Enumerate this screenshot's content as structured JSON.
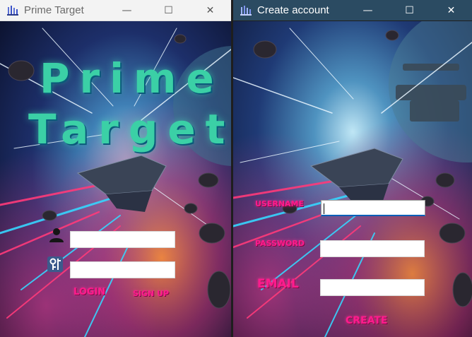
{
  "window_login": {
    "title": "Prime Target",
    "heading_line1": "Prime",
    "heading_line2": "Target",
    "login_label": "LOGIN",
    "signup_label": "SIGN UP",
    "icons": [
      "user-icon",
      "key-icon",
      "app-icon",
      "minimize-icon",
      "maximize-icon",
      "close-icon"
    ]
  },
  "window_create": {
    "title": "Create account",
    "username_label": "USERNAME",
    "password_label": "PASSWORD",
    "email_label": "EMAIL",
    "create_label": "CREATE"
  },
  "controls": {
    "minimize": "—",
    "maximize": "☐",
    "close": "✕"
  },
  "colors": {
    "accent_pink": "#ff1b8d",
    "heading_teal": "#3bd0a6",
    "titlebar_active": "#2b4b62",
    "titlebar_inactive": "#f3f3f3",
    "input_focus": "#005fb8"
  }
}
